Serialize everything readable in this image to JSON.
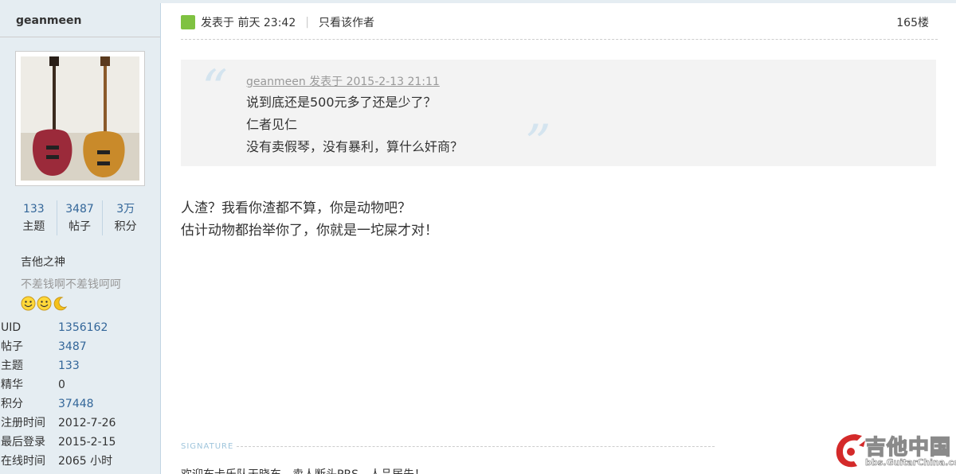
{
  "author": {
    "name": "geanmeen",
    "stats": [
      {
        "value": "133",
        "label": "主题"
      },
      {
        "value": "3487",
        "label": "帖子"
      },
      {
        "value": "3万",
        "label": "积分"
      }
    ],
    "rank": "吉他之神",
    "custom_title": "不差钱啊不差钱呵呵",
    "medal_icons": [
      "smiley-icon",
      "smiley-icon",
      "moon-icon"
    ],
    "info": [
      {
        "key": "UID",
        "value": "1356162",
        "link": true
      },
      {
        "key": "帖子",
        "value": "3487",
        "link": true
      },
      {
        "key": "主题",
        "value": "133",
        "link": true
      },
      {
        "key": "精华",
        "value": "0",
        "link": false
      },
      {
        "key": "积分",
        "value": "37448",
        "link": true
      },
      {
        "key": "注册时间",
        "value": "2012-7-26",
        "link": false
      },
      {
        "key": "最后登录",
        "value": "2015-2-15",
        "link": false
      },
      {
        "key": "在线时间",
        "value": "2065 小时",
        "link": false
      }
    ]
  },
  "post": {
    "posted_label": "发表于 前天 23:42",
    "only_author_label": "只看该作者",
    "floor": "165楼",
    "quote": {
      "header": "geanmeen 发表于 2015-2-13 21:11",
      "lines": [
        "说到底还是500元多了还是少了？",
        "仁者见仁",
        "没有卖假琴，没有暴利，算什么奸商？"
      ]
    },
    "body_lines": [
      "人渣？我看你渣都不算，你是动物吧？",
      "估计动物都抬举你了，你就是一坨屎才对！"
    ],
    "signature_label": "SIGNATURE",
    "signature_text": "欢迎布卡乐队天晓东，卖人断头PRS，人品居先！"
  },
  "watermark": {
    "text": "吉他中国",
    "url": "bbs.GuitarChina.com"
  },
  "colors": {
    "sidebar_bg": "#e5edf2",
    "link": "#336699",
    "online": "#7fc241"
  }
}
